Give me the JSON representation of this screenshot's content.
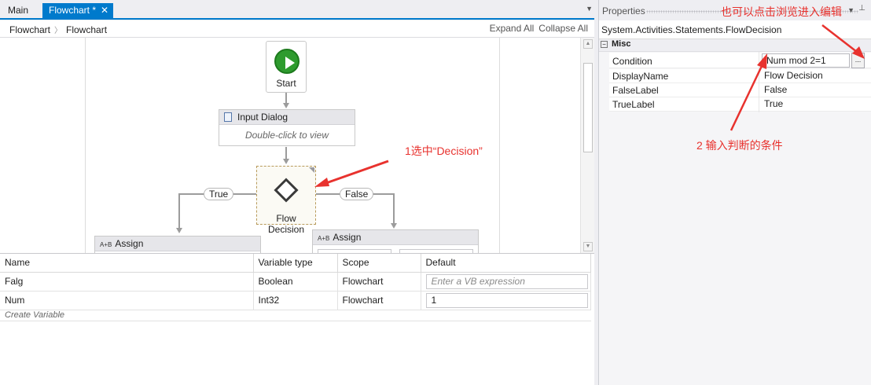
{
  "tabs": [
    {
      "label": "Main",
      "active": false
    },
    {
      "label": "Flowchart *",
      "active": true,
      "close": "✕"
    }
  ],
  "breadcrumb": [
    "Flowchart",
    "Flowchart"
  ],
  "toolbar": {
    "expand_all": "Expand All",
    "collapse_all": "Collapse All"
  },
  "canvas": {
    "start_label": "Start",
    "input_dialog": {
      "title": "Input Dialog",
      "body": "Double-click to view"
    },
    "decision_label": "Flow Decision",
    "true_label": "True",
    "false_label": "False",
    "assign_left": "Assign",
    "assign_right": "Assign",
    "assign_icon": "A+B",
    "annotation_select": "1选中“Decision”"
  },
  "variables": {
    "headers": [
      "Name",
      "Variable type",
      "Scope",
      "Default"
    ],
    "rows": [
      {
        "name": "Falg",
        "type": "Boolean",
        "scope": "Flowchart",
        "default": "Enter a VB expression",
        "placeholder": true
      },
      {
        "name": "Num",
        "type": "Int32",
        "scope": "Flowchart",
        "default": "1",
        "placeholder": false
      }
    ],
    "create": "Create Variable"
  },
  "properties": {
    "title": "Properties",
    "pin": "⊥",
    "type": "System.Activities.Statements.FlowDecision",
    "category": "Misc",
    "collapse_glyph": "−",
    "rows": [
      {
        "key": "Condition",
        "value": "Num mod 2=1"
      },
      {
        "key": "DisplayName",
        "value": "Flow Decision"
      },
      {
        "key": "FalseLabel",
        "value": "False"
      },
      {
        "key": "TrueLabel",
        "value": "True"
      }
    ],
    "ellipsis": "...",
    "annotation_browse": "也可以点击浏览进入编辑",
    "annotation_condition": "2 输入判断的条件"
  },
  "colors": {
    "accent": "#007acc",
    "annotation": "#e8322e",
    "start_green": "#2e9b2e"
  }
}
